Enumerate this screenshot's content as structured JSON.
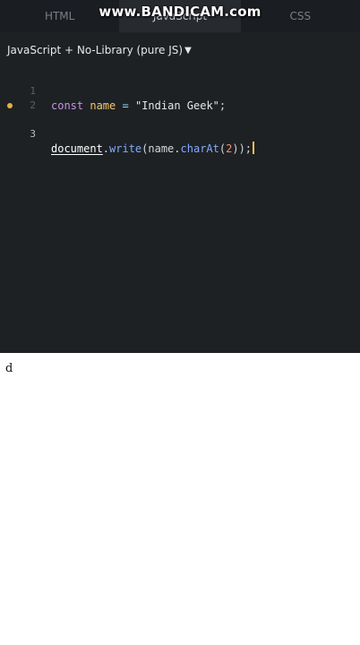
{
  "tabs": [
    {
      "label": "HTML",
      "active": false
    },
    {
      "label": "JavaScript",
      "active": true
    },
    {
      "label": "CSS",
      "active": false
    }
  ],
  "watermark": "www.BANDICAM.com",
  "editor": {
    "language_label": "JavaScript + No-Library (pure JS)",
    "lines": [
      {
        "number": "1",
        "tokens": {
          "kw": "const",
          "var": "name",
          "op": "=",
          "str": "\"Indian Geek\"",
          "end": ";"
        }
      },
      {
        "number": "2"
      },
      {
        "number": "3",
        "tokens": {
          "obj": "document",
          "dot1": ".",
          "fn1": "write",
          "p1": "(name.",
          "fn2": "charAt",
          "p2": "(",
          "num": "2",
          "p3": "));"
        }
      }
    ],
    "colors": {
      "background": "#1e2124",
      "keyword": "#c792ea",
      "variable": "#f6c86a",
      "function": "#82aaff",
      "number": "#f78c6c",
      "marker": "#e3b341"
    }
  },
  "output": {
    "text": "d"
  }
}
